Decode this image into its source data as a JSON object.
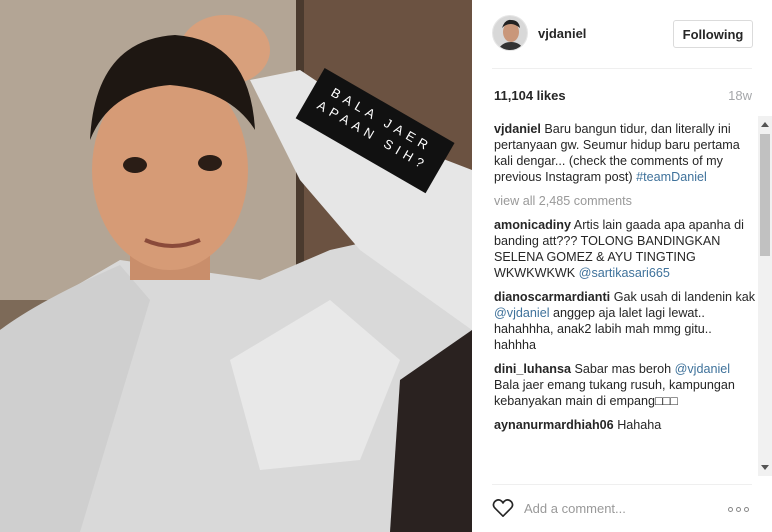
{
  "photo": {
    "alt": "selfie photo",
    "sticker_line1": "BALA JAER",
    "sticker_line2": "APAAN SIH?"
  },
  "header": {
    "username": "vjdaniel",
    "follow_label": "Following"
  },
  "stats": {
    "likes": "11,104 likes",
    "age": "18w"
  },
  "caption": {
    "user": "vjdaniel",
    "text": "Baru bangun tidur, dan literally ini pertanyaan gw. Seumur hidup baru pertama kali dengar... (check the comments of my previous Instagram post)",
    "tag": "#teamDaniel"
  },
  "view_all": "view all 2,485 comments",
  "comments": [
    {
      "user": "amonicadiny",
      "text": "Artis lain gaada apa apanha di banding att??? TOLONG BANDINGKAN SELENA GOMEZ & AYU TINGTING WKWKWKWK",
      "mention": "@sartikasari665",
      "tail": ""
    },
    {
      "user": "dianoscarmardianti",
      "text": "Gak usah di landenin kak",
      "mention": "@vjdaniel",
      "tail": "anggep aja lalet lagi lewat.. hahahhha, anak2 labih mah mmg gitu.. hahhha"
    },
    {
      "user": "dini_luhansa",
      "text": "Sabar mas beroh",
      "mention": "@vjdaniel",
      "tail": "Bala jaer emang tukang rusuh, kampungan kebanyakan main di empang□□□"
    },
    {
      "user": "aynanurmardhiah06",
      "text": "Hahaha",
      "mention": "",
      "tail": ""
    }
  ],
  "footer": {
    "add_comment_placeholder": "Add a comment..."
  },
  "icons": {
    "like": "heart-icon",
    "more": "more-options-icon"
  }
}
